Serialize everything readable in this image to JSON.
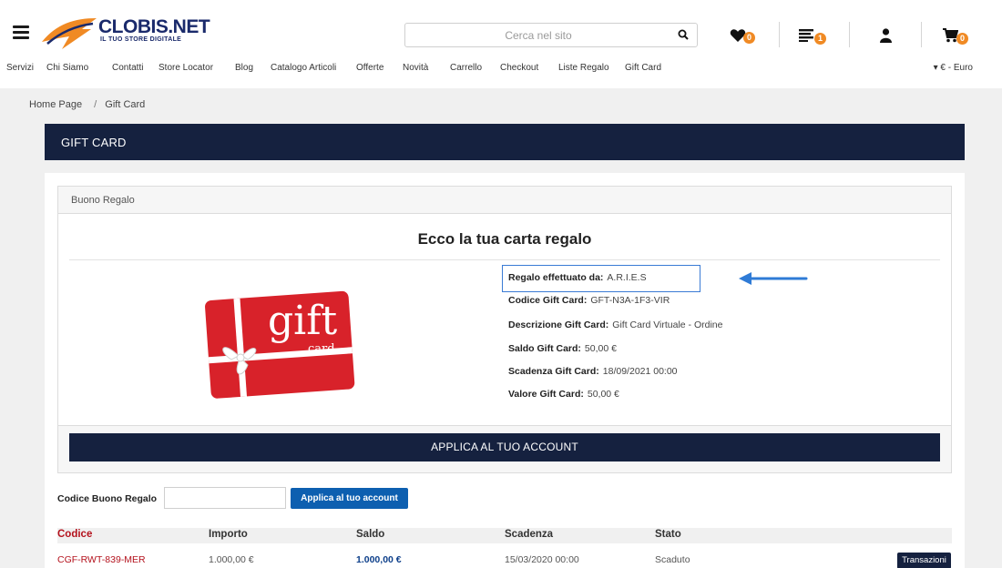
{
  "header": {
    "logo_name": "CLOBIS.NET",
    "logo_tagline": "IL TUO STORE DIGITALE",
    "search_placeholder": "Cerca nel sito",
    "wishlist_count": "0",
    "lists_count": "1",
    "cart_count": "0",
    "accent_color": "#f08a24",
    "brand_color": "#15213f"
  },
  "nav": {
    "items": [
      "Servizi",
      "Chi Siamo",
      "Contatti",
      "Store Locator",
      "Blog",
      "Catalogo Articoli",
      "Offerte",
      "Novità",
      "Carrello",
      "Checkout",
      "Liste Regalo",
      "Gift Card"
    ],
    "currency": "▾ € - Euro"
  },
  "breadcrumb": {
    "home": "Home Page",
    "separator": "/",
    "current": "Gift Card"
  },
  "page_title": "GIFT CARD",
  "card": {
    "header": "Buono Regalo",
    "title": "Ecco la tua carta regalo",
    "image_text": "gift",
    "image_subtext": "card",
    "details": [
      {
        "label": "Regalo effettuato da:",
        "value": "A.R.I.E.S"
      },
      {
        "label": "Codice Gift Card:",
        "value": "GFT-N3A-1F3-VIR"
      },
      {
        "label": "Descrizione Gift Card:",
        "value": "Gift Card Virtuale - Ordine"
      },
      {
        "label": "Saldo Gift Card:",
        "value": "50,00 €"
      },
      {
        "label": "Scadenza Gift Card:",
        "value": "18/09/2021 00:00"
      },
      {
        "label": "Valore Gift Card:",
        "value": "50,00 €"
      }
    ],
    "apply_button": "APPLICA AL TUO ACCOUNT"
  },
  "voucher": {
    "label": "Codice Buono Regalo",
    "input_value": "",
    "apply_button": "Applica al tuo account"
  },
  "table": {
    "headers": [
      "Codice",
      "Importo",
      "Saldo",
      "Scadenza",
      "Stato"
    ],
    "rows": [
      {
        "codice": "CGF-RWT-839-MER",
        "importo": "1.000,00 €",
        "saldo": "1.000,00 €",
        "scadenza": "15/03/2020 00:00",
        "stato": "Scaduto",
        "action": "Transazioni"
      }
    ]
  }
}
